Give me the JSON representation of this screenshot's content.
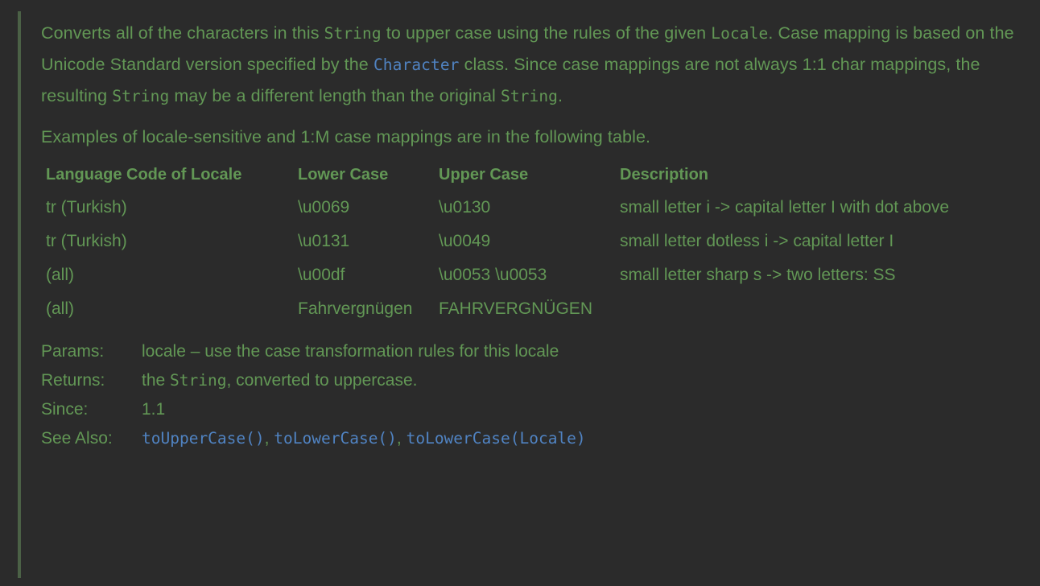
{
  "theme": {
    "background": "#2b2b2b",
    "text_green": "#629755",
    "link_blue": "#5083c2",
    "quote_bar": "#4b6146"
  },
  "doc": {
    "paragraphs": [
      {
        "id": "p1",
        "parts": [
          {
            "type": "text",
            "value": "Converts all of the characters in this "
          },
          {
            "type": "code",
            "value": "String"
          },
          {
            "type": "text",
            "value": " to upper case using the rules of the given "
          },
          {
            "type": "code",
            "value": "Locale"
          },
          {
            "type": "text",
            "value": ". Case mapping is based on the Unicode Standard version specified by the "
          },
          {
            "type": "link",
            "value": "Character"
          },
          {
            "type": "text",
            "value": " class. Since case mappings are not always 1:1 char mappings, the resulting "
          },
          {
            "type": "code",
            "value": "String"
          },
          {
            "type": "text",
            "value": " may be a different length than the original "
          },
          {
            "type": "code",
            "value": "String"
          },
          {
            "type": "text",
            "value": "."
          }
        ],
        "seg": {
          "t1": "Converts all of the characters in this ",
          "c1": "String",
          "t2": " to upper case using the rules of the given ",
          "c2": "Locale",
          "t3": ". Case mapping is based on the Unicode Standard version specified by the ",
          "l1": "Character",
          "t4": " class. Since case mappings are not always 1:1 char mappings, the resulting ",
          "c3": "String",
          "t5": " may be a different length than the original ",
          "c4": "String",
          "t6": "."
        }
      },
      {
        "id": "p2",
        "text": "Examples of locale-sensitive and 1:M case mappings are in the following table."
      }
    ],
    "table": {
      "headers": {
        "language_code": "Language Code of Locale",
        "lower_case": "Lower Case",
        "upper_case": "Upper Case",
        "description": "Description"
      },
      "rows": [
        {
          "language_code": "tr (Turkish)",
          "lower_case": "\\u0069",
          "upper_case": "\\u0130",
          "description": "small letter i -> capital letter I with dot above"
        },
        {
          "language_code": "tr (Turkish)",
          "lower_case": "\\u0131",
          "upper_case": "\\u0049",
          "description": "small letter dotless i -> capital letter I"
        },
        {
          "language_code": "(all)",
          "lower_case": "\\u00df",
          "upper_case": "\\u0053 \\u0053",
          "description": "small letter sharp s -> two letters: SS"
        },
        {
          "language_code": "(all)",
          "lower_case": "Fahrvergnügen",
          "upper_case": "FAHRVERGNÜGEN",
          "description": ""
        }
      ]
    },
    "tags": {
      "params": {
        "label": "Params:",
        "param_name": "locale",
        "dash": " – ",
        "description": "use the case transformation rules for this locale"
      },
      "returns": {
        "label": "Returns:",
        "prefix": "the ",
        "code": "String",
        "suffix": ", converted to uppercase."
      },
      "since": {
        "label": "Since:",
        "value": "1.1"
      },
      "see_also": {
        "label": "See Also:",
        "links": [
          "toUpperCase()",
          "toLowerCase()",
          "toLowerCase(Locale)"
        ],
        "separator": ", "
      }
    }
  }
}
